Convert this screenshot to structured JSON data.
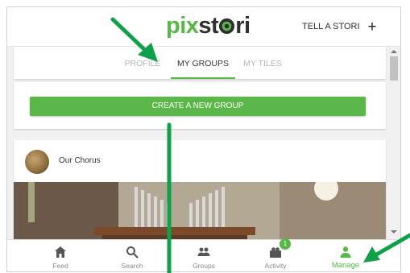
{
  "header": {
    "logo_prefix": "pix",
    "logo_suffix": "st",
    "logo_o": "o",
    "logo_end": "ri",
    "action_label": "TELL A STORI",
    "action_icon": "plus-icon"
  },
  "tabs": [
    {
      "label": "PROFILE",
      "active": false
    },
    {
      "label": "MY GROUPS",
      "active": true
    },
    {
      "label": "MY TILES",
      "active": false
    }
  ],
  "create_group": {
    "label": "CREATE A NEW GROUP"
  },
  "group": {
    "name": "Our Chorus",
    "avatar": "group-avatar"
  },
  "bottom_nav": [
    {
      "label": "Feed",
      "icon": "home-icon"
    },
    {
      "label": "Search",
      "icon": "search-icon"
    },
    {
      "label": "Groups",
      "icon": "groups-icon"
    },
    {
      "label": "Activity",
      "icon": "activity-icon",
      "badge": "1"
    },
    {
      "label": "Manage",
      "icon": "person-icon",
      "active": true
    }
  ],
  "colors": {
    "brand_green": "#57b847",
    "button_green": "#5cb74a",
    "annotation_arrow": "#10a04a",
    "text_dark": "#2f2f2f"
  }
}
